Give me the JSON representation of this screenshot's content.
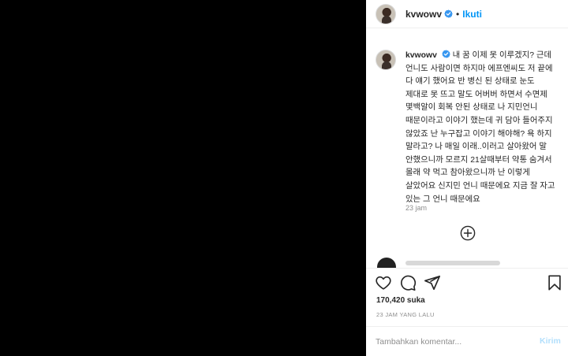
{
  "post": {
    "username": "kvwowv",
    "follow_label": "Ikuti",
    "separator": "•"
  },
  "caption": {
    "username": "kvwowv",
    "text": "내 꿈 이제 못 이루겠지? 근데 언니도 사람이면 하지마 에프엔씨도 저 끝에 다 얘기 했어요 반 병신 된 상태로 눈도 제대로 못 뜨고 말도 어버버 하면서 수면제 몇백알이 회복 안된 상태로 나 지민언니 때문이라고 이야기 했는데 귀 담아 들어주지 않았죠 난 누구잡고 이야기 해야해? 욕 하지 말라고? 나 매일 이래..이러고 살아왔어 말 안했으니까 모르지 21살때부터 약통 숨겨서 몰래 약 먹고 참아왔으니까 난 이렇게 살았어요 신지민 언니 때문에요 지금 잘 자고 있는 그 언니 때문에요",
    "time": "23 jam"
  },
  "actions": {
    "likes": "170,420 suka",
    "time_ago": "23 JAM YANG LALU"
  },
  "comment_box": {
    "placeholder": "Tambahkan komentar...",
    "post_label": "Kirim"
  },
  "icons": {
    "like": "heart-icon",
    "comment": "comment-icon",
    "share": "share-icon",
    "save": "bookmark-icon",
    "load_more": "plus-circle-icon",
    "verified": "verified-badge-icon"
  },
  "colors": {
    "accent": "#0095f6",
    "verified": "#3897f0",
    "muted": "#8e8e8e",
    "post_disabled": "#b2dffc"
  }
}
